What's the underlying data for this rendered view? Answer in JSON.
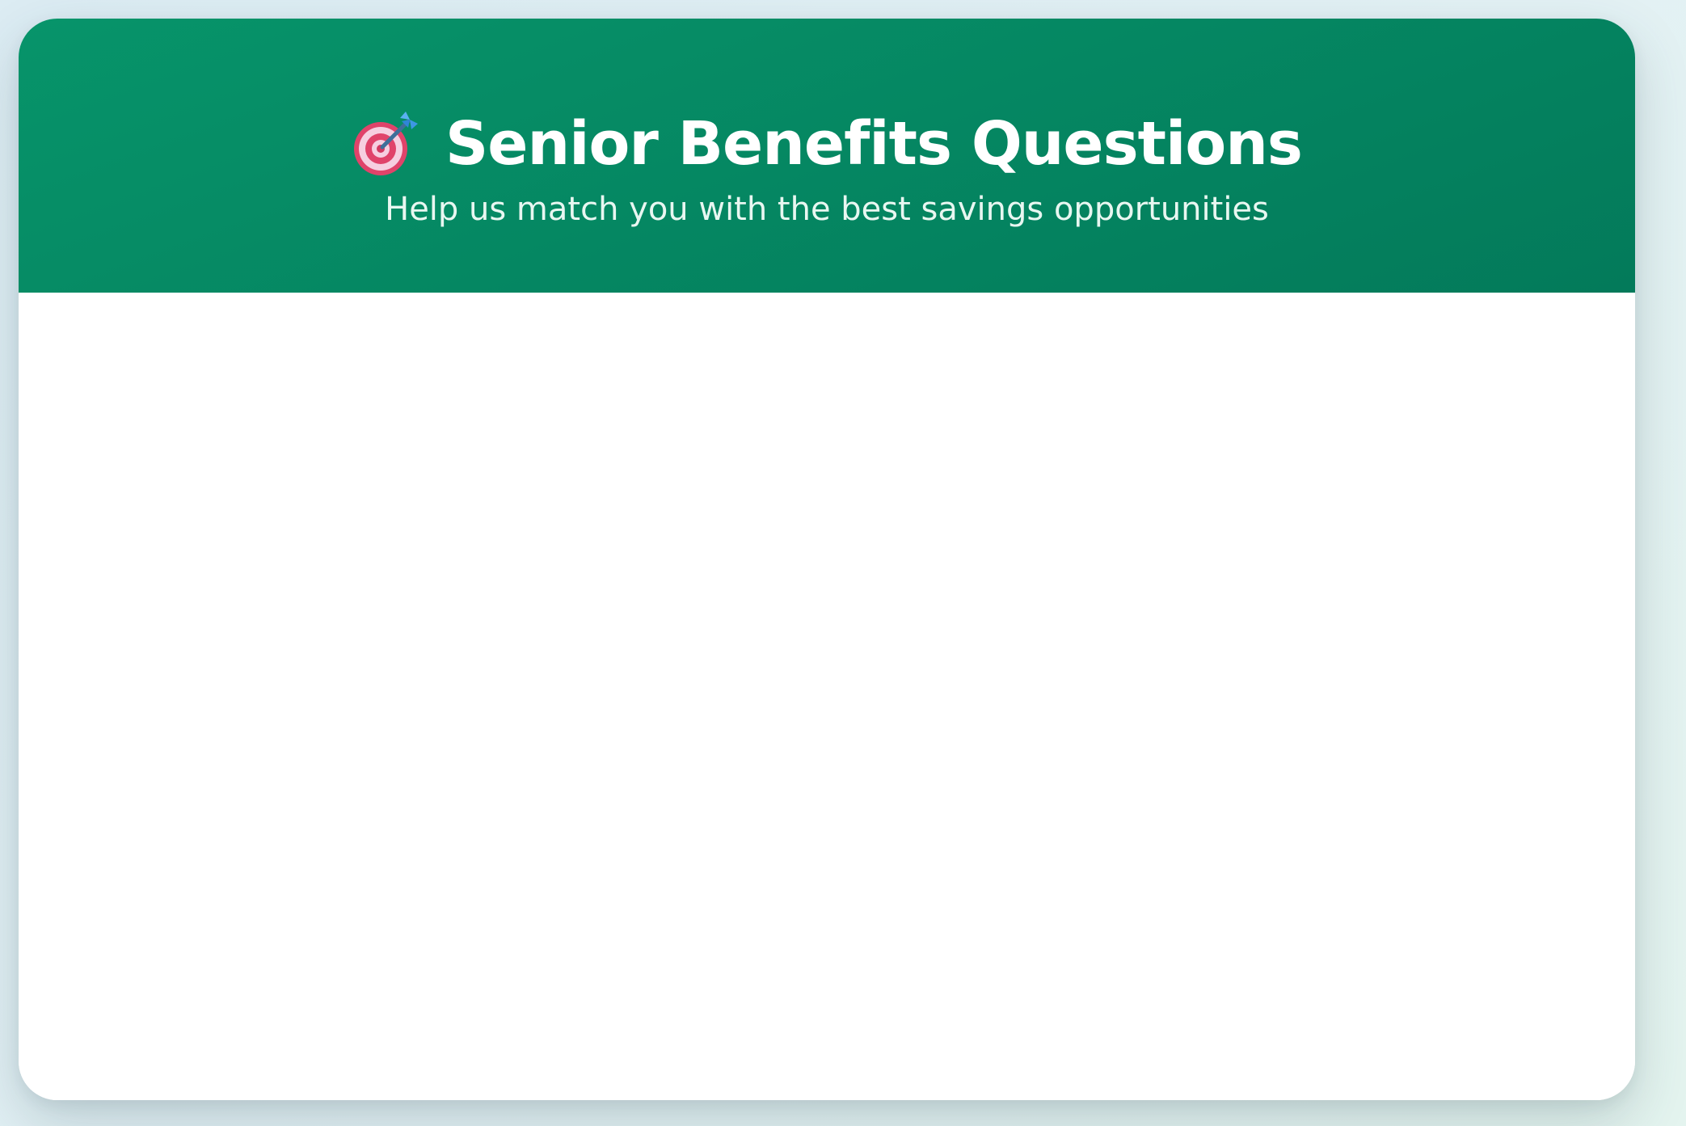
{
  "header": {
    "icon": "target-dart-icon",
    "title": "Senior Benefits Questions",
    "subtitle": "Help us match you with the best savings opportunities"
  },
  "colors": {
    "page_background": "#e1eff3",
    "header_green": "#058762",
    "card_background": "#ffffff",
    "title_text": "#ffffff"
  }
}
